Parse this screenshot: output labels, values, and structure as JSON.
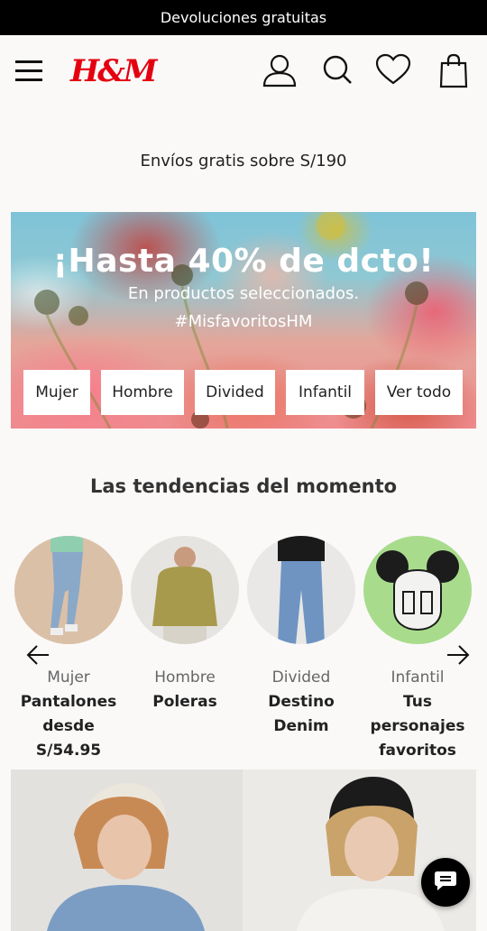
{
  "topbar": {
    "text": "Devoluciones gratuitas"
  },
  "header": {
    "logo": "H&M",
    "icons": [
      "menu-icon",
      "user-icon",
      "search-icon",
      "heart-icon",
      "shopping-bag-icon"
    ]
  },
  "shipping": {
    "text": "Envíos gratis sobre S/190"
  },
  "banner": {
    "title": "¡Hasta 40% de dcto!",
    "subtitle": "En productos seleccionados.",
    "hashtag": "#MisfavoritosHM",
    "buttons": [
      "Mujer",
      "Hombre",
      "Divided",
      "Infantil",
      "Ver todo"
    ]
  },
  "trends": {
    "title": "Las tendencias del momento",
    "items": [
      {
        "category": "Mujer",
        "desc": "Pantalones desde S/54.95"
      },
      {
        "category": "Hombre",
        "desc": "Poleras"
      },
      {
        "category": "Divided",
        "desc": "Destino Denim"
      },
      {
        "category": "Infantil",
        "desc": "Tus personajes favoritos"
      }
    ]
  },
  "colors": {
    "brand_red": "#e50010",
    "topbar_bg": "#000000",
    "page_bg": "#faf9f8"
  }
}
